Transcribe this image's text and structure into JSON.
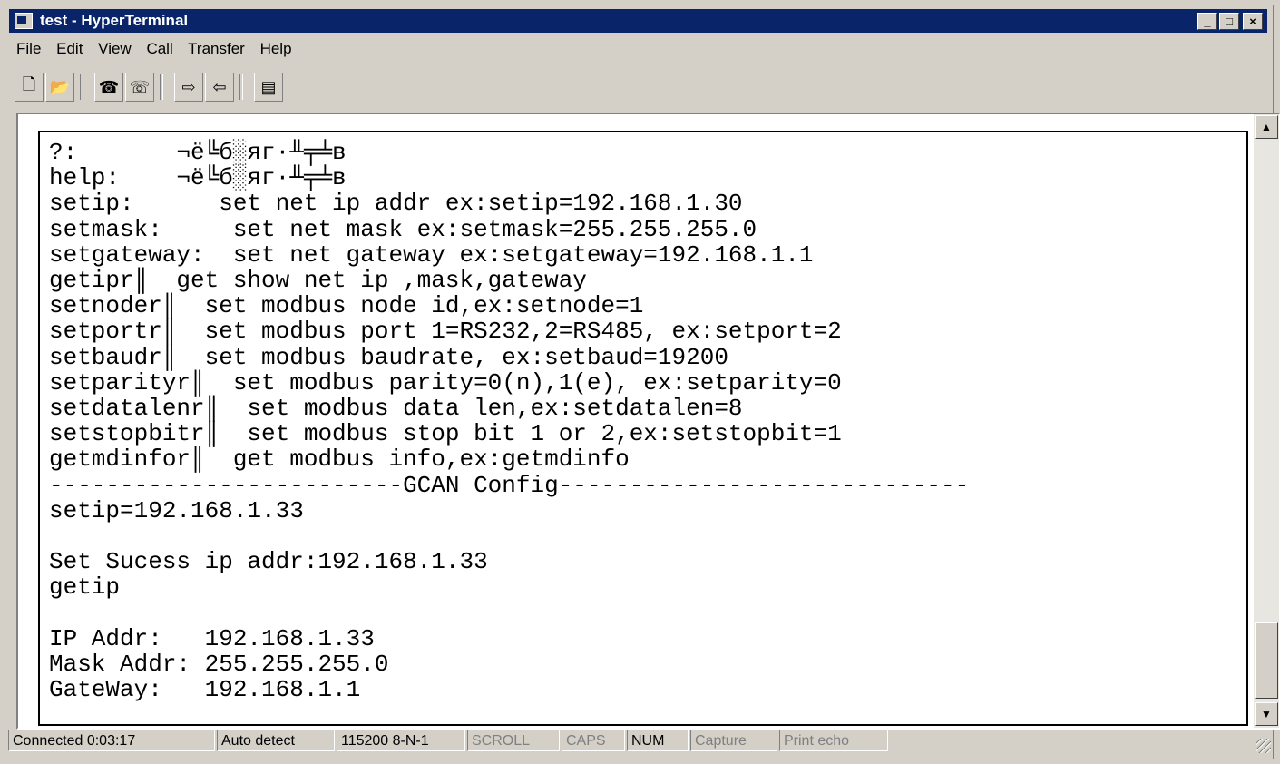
{
  "window": {
    "title": "test - HyperTerminal"
  },
  "title_buttons": {
    "minimize": "_",
    "maximize": "□",
    "close": "×"
  },
  "menu": [
    "File",
    "Edit",
    "View",
    "Call",
    "Transfer",
    "Help"
  ],
  "toolbar": [
    "new-icon",
    "open-icon",
    "disconnect-icon",
    "dial-icon",
    "send-icon",
    "receive-icon",
    "properties-icon"
  ],
  "terminal": {
    "lines": [
      "?:       ¬ё╚б░яг·╨╤╧в",
      "help:    ¬ё╚б░яг·╨╤╧в",
      "setip:      set net ip addr ex:setip=192.168.1.30",
      "setmask:     set net mask ex:setmask=255.255.255.0",
      "setgateway:  set net gateway ex:setgateway=192.168.1.1",
      "getipr║  get show net ip ,mask,gateway",
      "setnoder║  set modbus node id,ex:setnode=1",
      "setportr║  set modbus port 1=RS232,2=RS485, ex:setport=2",
      "setbaudr║  set modbus baudrate, ex:setbaud=19200",
      "setparityr║  set modbus parity=0(n),1(e), ex:setparity=0",
      "setdatalenr║  set modbus data len,ex:setdatalen=8",
      "setstopbitr║  set modbus stop bit 1 or 2,ex:setstopbit=1",
      "getmdinfor║  get modbus info,ex:getmdinfo",
      "-------------------------GCAN Config-----------------------------",
      "setip=192.168.1.33",
      "",
      "Set Sucess ip addr:192.168.1.33",
      "getip",
      "",
      "IP Addr:   192.168.1.33",
      "Mask Addr: 255.255.255.0",
      "GateWay:   192.168.1.1",
      "",
      "_"
    ]
  },
  "status": {
    "connected": "Connected 0:03:17",
    "detect": "Auto detect",
    "port": "115200 8-N-1",
    "scroll": "SCROLL",
    "caps": "CAPS",
    "num": "NUM",
    "capture": "Capture",
    "print": "Print echo"
  }
}
